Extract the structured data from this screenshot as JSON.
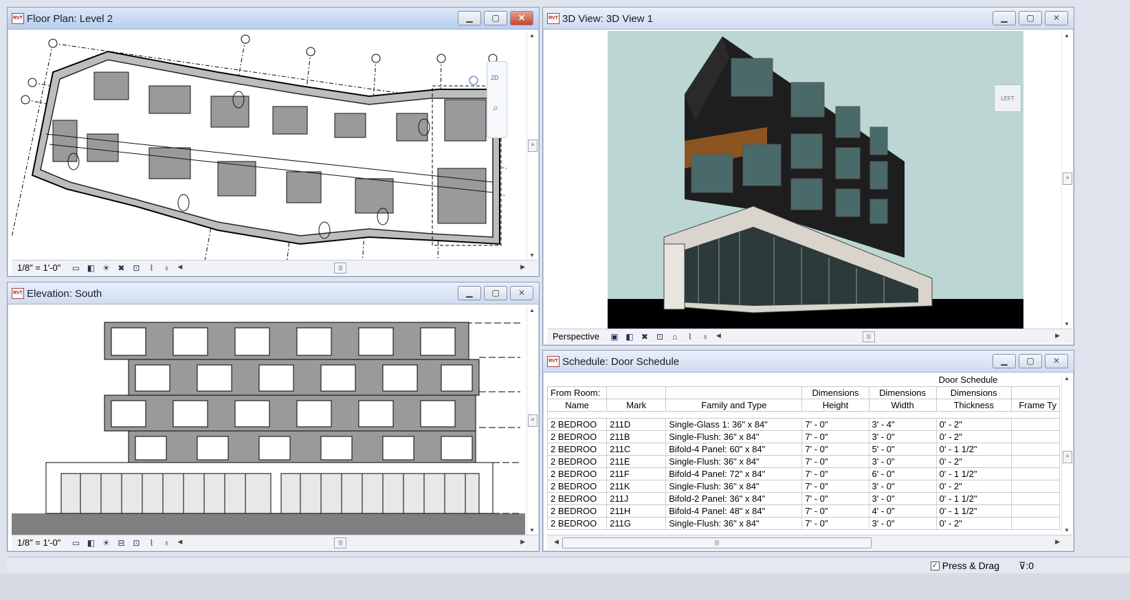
{
  "windows": {
    "floor_plan": {
      "title": "Floor Plan: Level 2",
      "scale": "1/8\" = 1'-0\"",
      "nav_label": "2D"
    },
    "elevation": {
      "title": "Elevation: South",
      "scale": "1/8\" = 1'-0\""
    },
    "view3d": {
      "title": "3D View: 3D View 1",
      "mode": "Perspective",
      "cube_label": "LEFT"
    },
    "schedule": {
      "title": "Schedule: Door Schedule",
      "table_title": "Door Schedule",
      "headers_top": [
        "From Room:",
        "",
        "",
        "Dimensions",
        "Dimensions",
        "Dimensions",
        ""
      ],
      "headers_bottom": [
        "Name",
        "Mark",
        "Family and Type",
        "Height",
        "Width",
        "Thickness",
        "Frame Ty"
      ],
      "rows": [
        [
          "2 BEDROO",
          "211D",
          "Single-Glass 1: 36\" x 84\"",
          "7' - 0\"",
          "3' - 4\"",
          "0' - 2\"",
          ""
        ],
        [
          "2 BEDROO",
          "211B",
          "Single-Flush: 36\" x 84\"",
          "7' - 0\"",
          "3' - 0\"",
          "0' - 2\"",
          ""
        ],
        [
          "2 BEDROO",
          "211C",
          "Bifold-4 Panel: 60\" x 84\"",
          "7' - 0\"",
          "5' - 0\"",
          "0' - 1 1/2\"",
          ""
        ],
        [
          "2 BEDROO",
          "211E",
          "Single-Flush: 36\" x 84\"",
          "7' - 0\"",
          "3' - 0\"",
          "0' - 2\"",
          ""
        ],
        [
          "2 BEDROO",
          "211F",
          "Bifold-4 Panel: 72\" x 84\"",
          "7' - 0\"",
          "6' - 0\"",
          "0' - 1 1/2\"",
          ""
        ],
        [
          "2 BEDROO",
          "211K",
          "Single-Flush: 36\" x 84\"",
          "7' - 0\"",
          "3' - 0\"",
          "0' - 2\"",
          ""
        ],
        [
          "2 BEDROO",
          "211J",
          "Bifold-2 Panel: 36\" x 84\"",
          "7' - 0\"",
          "3' - 0\"",
          "0' - 1 1/2\"",
          ""
        ],
        [
          "2 BEDROO",
          "211H",
          "Bifold-4 Panel: 48\" x 84\"",
          "7' - 0\"",
          "4' - 0\"",
          "0' - 1 1/2\"",
          ""
        ],
        [
          "2 BEDROO",
          "211G",
          "Single-Flush: 36\" x 84\"",
          "7' - 0\"",
          "3' - 0\"",
          "0' - 2\"",
          ""
        ]
      ]
    }
  },
  "statusbar": {
    "press_drag": "Press & Drag",
    "filter_count": ":0"
  },
  "app_icon_label": "RVT",
  "colors": {
    "sky": "#bcd6d4",
    "ground": "#000000",
    "cladding": "#1e1e1e",
    "podium": "#d9d5cc",
    "accent_wood": "#8a5520"
  }
}
